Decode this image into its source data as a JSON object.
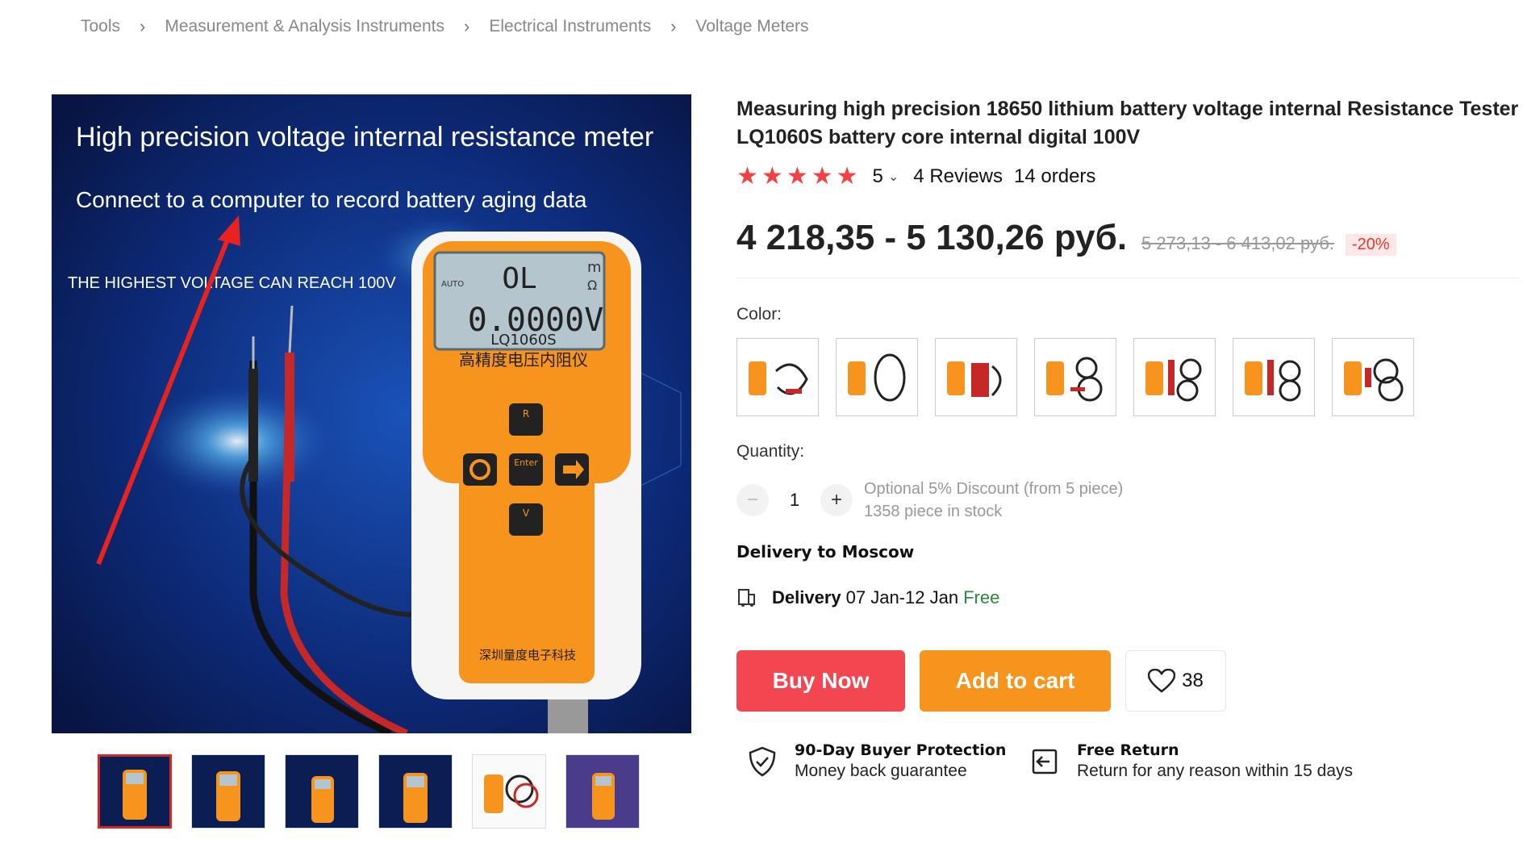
{
  "breadcrumb": [
    "Tools",
    "Measurement & Analysis Instruments",
    "Electrical Instruments",
    "Voltage Meters"
  ],
  "main_image": {
    "headline": "High precision voltage internal resistance meter",
    "subline": "Connect to a computer to record battery aging data",
    "note": "THE HIGHEST VOLTAGE CAN REACH 100V",
    "display_top": "OL",
    "display_bottom": "0.0000V",
    "display_auto": "AUTO",
    "display_unit_top": "m",
    "display_unit_ohm": "Ω",
    "model": "LQ1060S",
    "device_name": "高精度电压内阻仪",
    "maker": "深圳量度电子科技",
    "key_r": "R",
    "key_enter": "Enter",
    "key_v": "V"
  },
  "product": {
    "title": "Measuring high precision 18650 lithium battery voltage internal Resistance Tester LQ1060S battery core internal digital 100V",
    "rating": "5",
    "reviews": "4 Reviews",
    "orders": "14 orders",
    "price": "4 218,35 - 5 130,26 руб.",
    "old_price": "5 273,13 - 6 413,02 руб.",
    "discount": "-20%"
  },
  "color": {
    "label": "Color:",
    "options": 7
  },
  "quantity": {
    "label": "Quantity:",
    "minus": "−",
    "plus": "+",
    "value": "1",
    "discount_note": "Optional 5% Discount (from 5 piece)",
    "stock": "1358 piece in stock"
  },
  "delivery": {
    "to": "Delivery to Moscow",
    "label": "Delivery",
    "dates": "07 Jan-12 Jan",
    "price": "Free"
  },
  "actions": {
    "buy_now": "Buy Now",
    "add_to_cart": "Add to cart",
    "wishlist_count": "38"
  },
  "guarantees": [
    {
      "title": "90-Day Buyer Protection",
      "sub": "Money back guarantee"
    },
    {
      "title": "Free Return",
      "sub": "Return for any reason within 15 days"
    }
  ],
  "colors": {
    "buy": "#f24650",
    "cart": "#f7941d",
    "star": "#f44040",
    "discount": "#e03a2e",
    "free": "#2b8a3e"
  }
}
